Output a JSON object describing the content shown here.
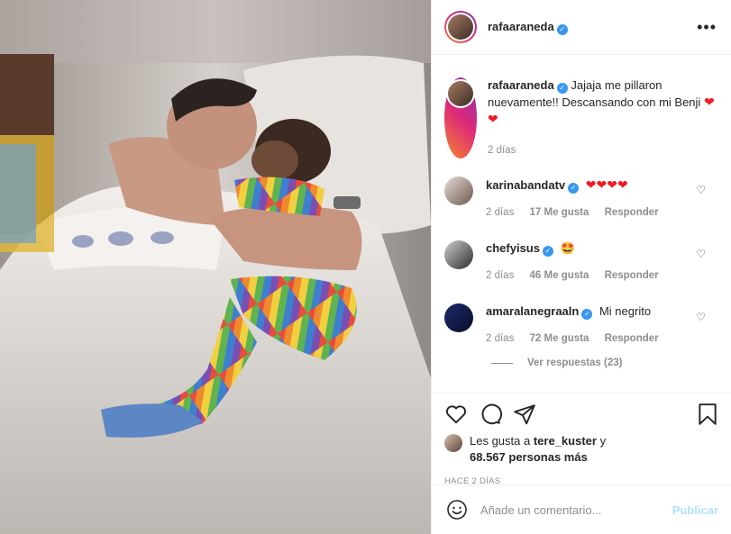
{
  "post": {
    "author": "rafaaraneda",
    "more_icon": "more-horizontal-icon"
  },
  "caption": {
    "username": "rafaaraneda",
    "text": "Jajaja me pillaron nuevamente!! Descansando con mi Benji",
    "emoji": "❤❤",
    "time": "2 días"
  },
  "comments": [
    {
      "username": "karinabandatv",
      "verified": true,
      "text": "",
      "emoji": "❤❤❤❤",
      "time": "2 días",
      "likes": "17 Me gusta",
      "reply": "Responder"
    },
    {
      "username": "chefyisus",
      "verified": true,
      "text": "",
      "emoji": "🤩",
      "time": "2 días",
      "likes": "46 Me gusta",
      "reply": "Responder"
    },
    {
      "username": "amaralanegraaln",
      "verified": true,
      "text": "Mi negrito",
      "emoji": "",
      "time": "2 días",
      "likes": "72 Me gusta",
      "reply": "Responder"
    }
  ],
  "view_replies": "Ver respuestas (23)",
  "likes": {
    "prefix": "Les gusta a",
    "user": "tere_kuster",
    "suffix": "y",
    "count": "68.567",
    "others": "personas más"
  },
  "posted_ago": "HACE 2 DÍAS",
  "add_comment": {
    "placeholder": "Añade un comentario...",
    "publish": "Publicar"
  },
  "colors": {
    "verified": "#3897f0",
    "heart_emoji": "#ed1c24",
    "publish_disabled": "#b2dffc",
    "muted": "#8e8e8e"
  }
}
